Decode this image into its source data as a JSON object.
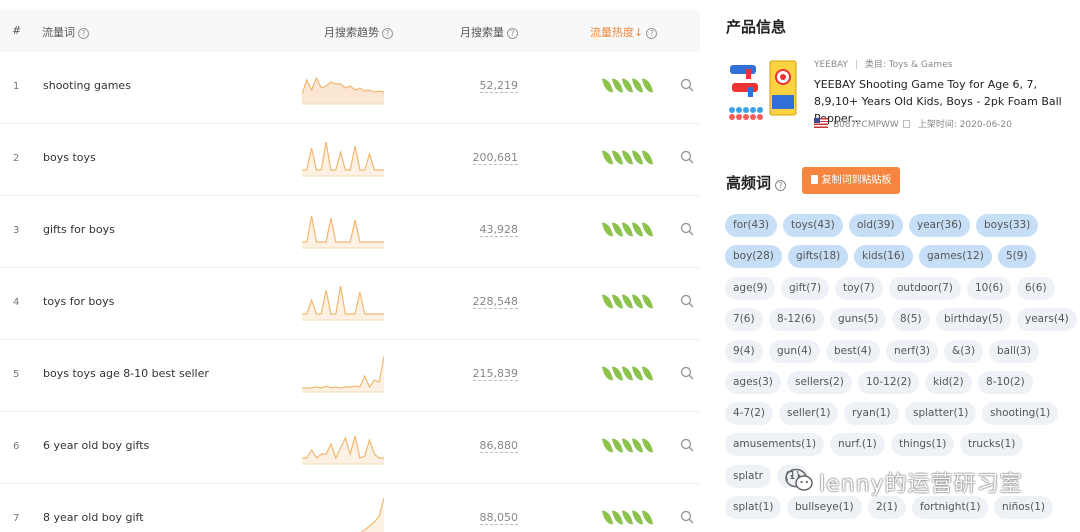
{
  "table": {
    "headers": {
      "num": "#",
      "keyword": "流量词",
      "trend": "月搜索趋势",
      "volume": "月搜索量",
      "hot": "流量热度",
      "hot_arrow": "↓"
    },
    "rows": [
      {
        "num": "1",
        "keyword": "shooting games",
        "volume": "52,219",
        "hot_level": 5
      },
      {
        "num": "2",
        "keyword": "boys toys",
        "volume": "200,681",
        "hot_level": 5
      },
      {
        "num": "3",
        "keyword": "gifts for boys",
        "volume": "43,928",
        "hot_level": 5
      },
      {
        "num": "4",
        "keyword": "toys for boys",
        "volume": "228,548",
        "hot_level": 5
      },
      {
        "num": "5",
        "keyword": "boys toys age 8-10 best seller",
        "volume": "215,839",
        "hot_level": 5
      },
      {
        "num": "6",
        "keyword": "6 year old boy gifts",
        "volume": "86,880",
        "hot_level": 5
      },
      {
        "num": "7",
        "keyword": "8 year old boy gift",
        "volume": "88,050",
        "hot_level": 5
      }
    ]
  },
  "product": {
    "section_title": "产品信息",
    "brand": "YEEBAY",
    "category": "类目: Toys & Games",
    "title": "YEEBAY Shooting Game Toy for Age 6, 7, 8,9,10+ Years Old Kids, Boys - 2pk Foam Ball Popper...",
    "asin": "B087FCMPWW",
    "launch_date": "上架时间: 2020-06-20"
  },
  "high_freq": {
    "section_title": "高频词",
    "copy_button": "复制词到粘贴板",
    "tags": [
      "for(43)",
      "toys(43)",
      "old(39)",
      "year(36)",
      "boys(33)",
      "boy(28)",
      "gifts(18)",
      "kids(16)",
      "games(12)",
      "5(9)",
      "age(9)",
      "gift(7)",
      "toy(7)",
      "outdoor(7)",
      "10(6)",
      "6(6)",
      "7(6)",
      "8-12(6)",
      "guns(5)",
      "8(5)",
      "birthday(5)",
      "years(4)",
      "9(4)",
      "gun(4)",
      "best(4)",
      "nerf(3)",
      "&(3)",
      "ball(3)",
      "ages(3)",
      "sellers(2)",
      "10-12(2)",
      "kid(2)",
      "8-10(2)",
      "4-7(2)",
      "seller(1)",
      "ryan(1)",
      "splatter(1)",
      "shooting(1)",
      "amusements(1)",
      "nurf.(1)",
      "things(1)",
      "trucks(1)",
      "splatr",
      "(1)",
      "splat(1)",
      "bullseye(1)",
      "2(1)",
      "fortnight(1)",
      "niños(1)"
    ],
    "highlighted": [
      0,
      1,
      2,
      3,
      4,
      5,
      6,
      7,
      8,
      9
    ]
  },
  "watermark": {
    "text": "lenny的运营研习室"
  },
  "colors": {
    "accent_orange": "#f5853f",
    "leaf_green": "#8bc24c",
    "sparkline": "#f0b870",
    "tag_highlight": "#c6dff7",
    "tag_default": "#eef2f7"
  }
}
